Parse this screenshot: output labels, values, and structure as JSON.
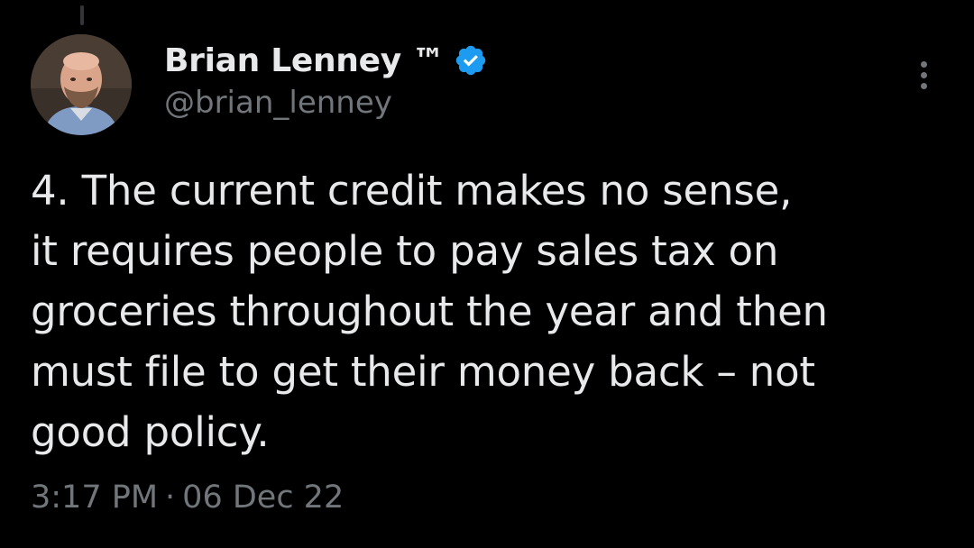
{
  "author": {
    "display_name": "Brian Lenney ™",
    "handle": "@brian_lenney",
    "verified": true,
    "verified_color": "#1d9bf0",
    "avatar_icon": "profile-photo"
  },
  "tweet": {
    "lines": [
      "4. The current credit makes no sense,",
      "it requires people to pay sales tax on",
      "groceries throughout the year and then",
      "must file to get their money back – not",
      "good policy."
    ]
  },
  "meta": {
    "time": "3:17 PM",
    "separator": "·",
    "date": "06 Dec 22"
  },
  "menu": {
    "icon": "more-options-icon"
  },
  "colors": {
    "background": "#000000",
    "primary_text": "#e7e9ea",
    "secondary_text": "#71767b"
  }
}
